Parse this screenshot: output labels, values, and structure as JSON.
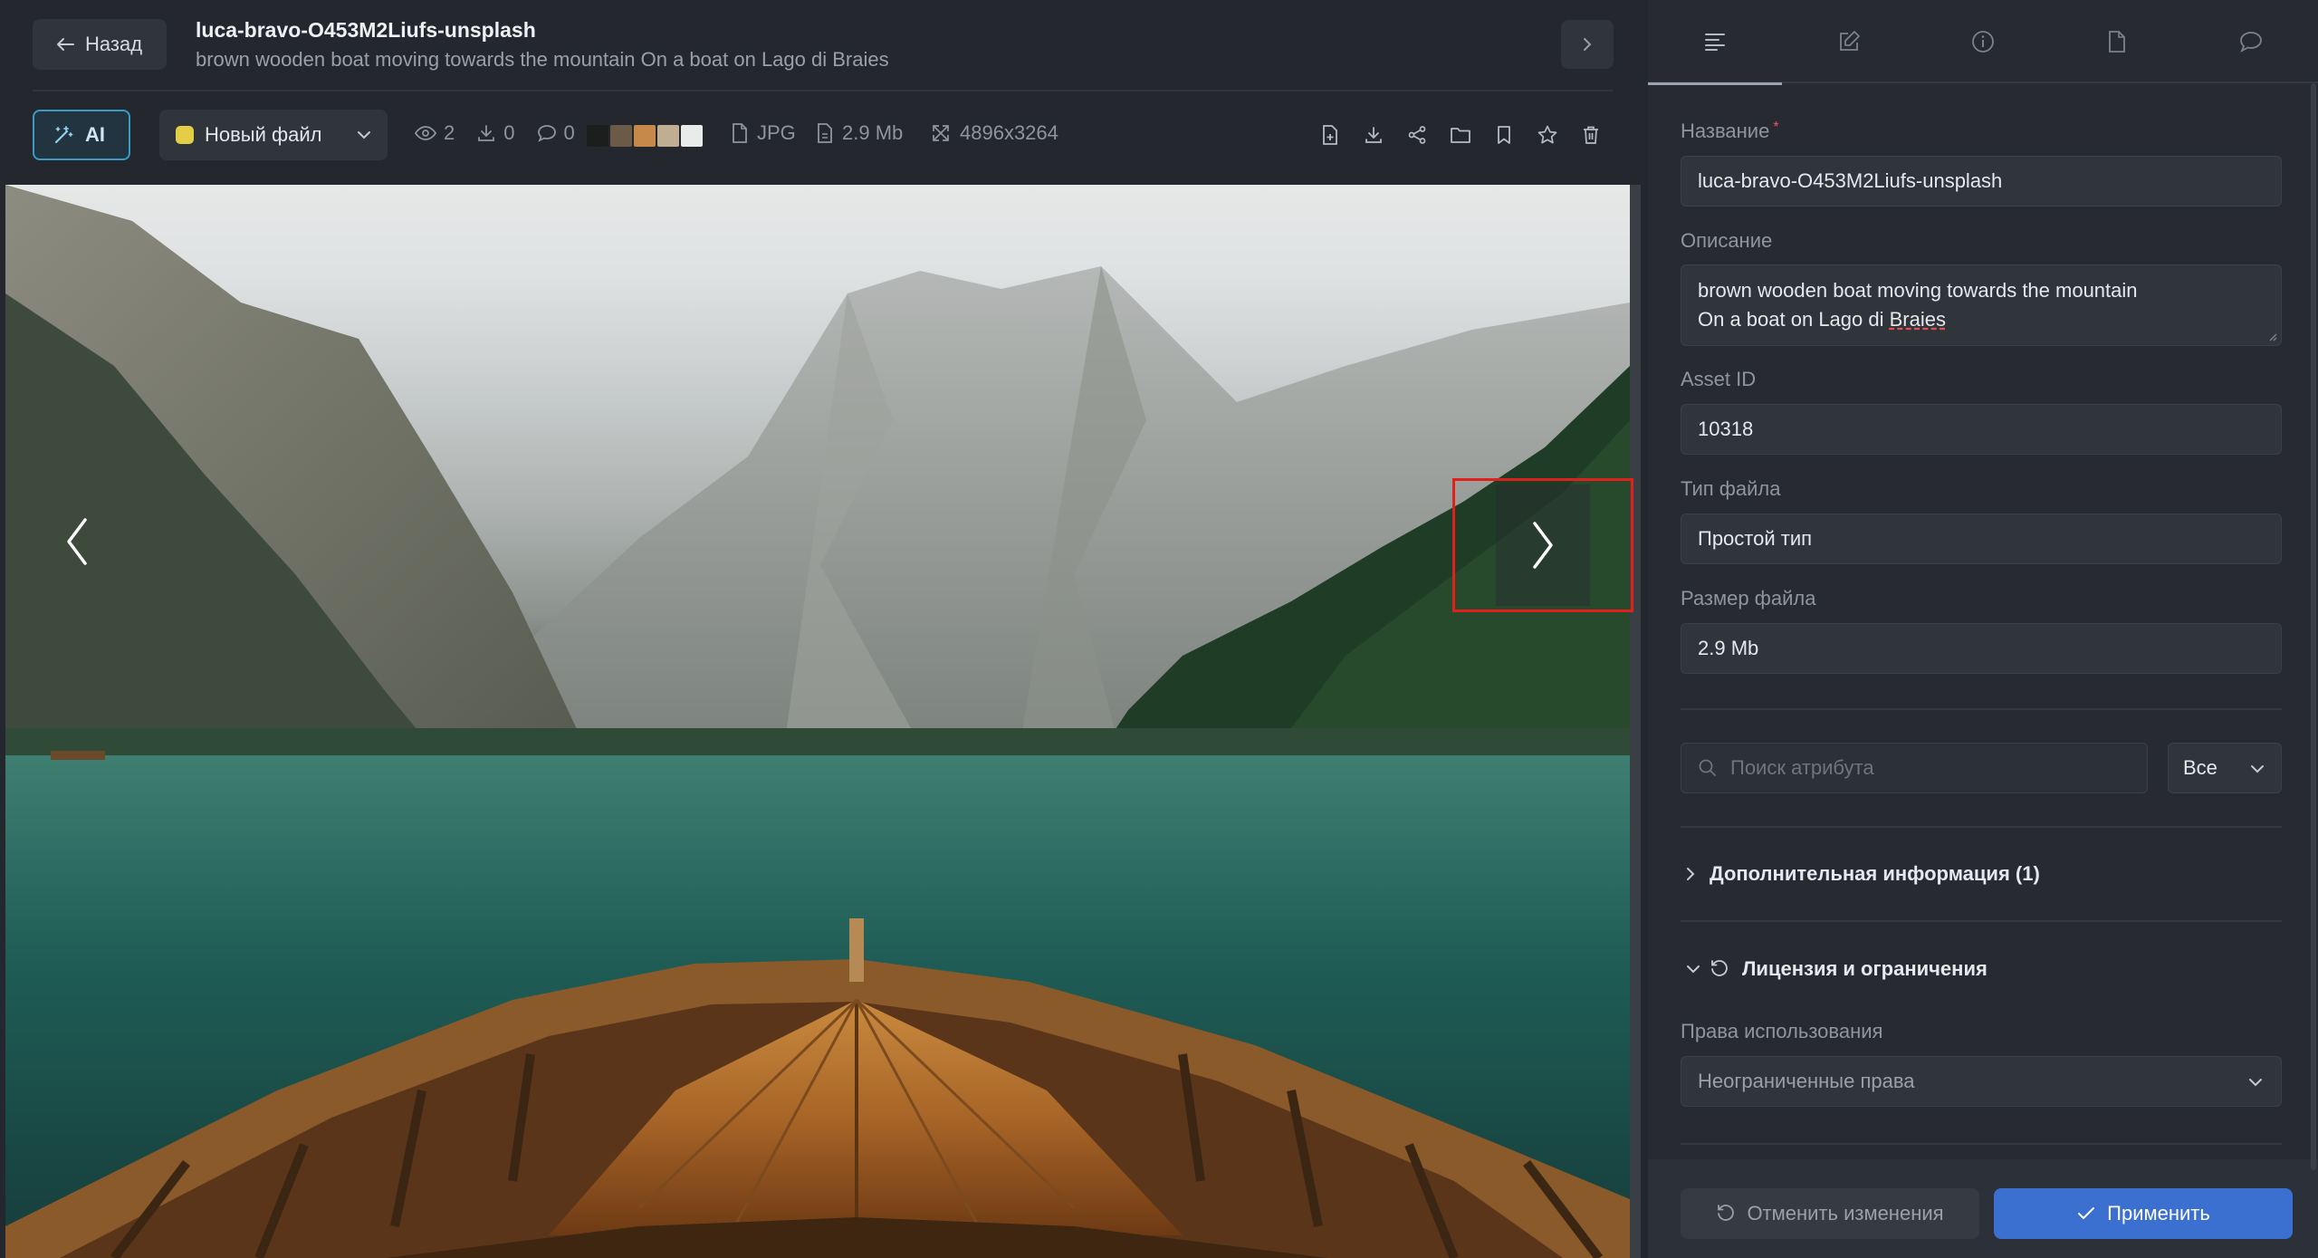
{
  "header": {
    "back_label": "Назад",
    "file_title": "luca-bravo-O453M2Liufs-unsplash",
    "file_subtitle": "brown wooden boat moving towards the mountain On a boat on Lago di Braies"
  },
  "toolbar": {
    "ai_label": "AI",
    "status_label": "Новый файл",
    "status_color": "#e4cd47",
    "views": "2",
    "downloads": "0",
    "comments": "0",
    "palette": [
      "#1c1e1d",
      "#6b5a45",
      "#c6894a",
      "#bfae92",
      "#e9ebea"
    ],
    "format": "JPG",
    "size": "2.9 Mb",
    "dimensions": "4896x3264",
    "actions": [
      "file-add-icon",
      "download-icon",
      "share-icon",
      "folder-icon",
      "bookmark-icon",
      "star-icon",
      "trash-icon"
    ]
  },
  "panel": {
    "tabs": [
      "list-icon",
      "edit-icon",
      "info-icon",
      "file-icon",
      "comment-icon"
    ],
    "name_label": "Название",
    "name_required": "*",
    "name_value": "luca-bravo-O453M2Liufs-unsplash",
    "description_label": "Описание",
    "description_line1": "brown wooden boat moving towards the mountain",
    "description_line2_prefix": "On a boat on Lago di ",
    "description_line2_word": "Braies",
    "asset_id_label": "Asset ID",
    "asset_id_value": "10318",
    "file_type_label": "Тип файла",
    "file_type_value": "Простой тип",
    "file_size_label": "Размер файла",
    "file_size_value": "2.9 Mb",
    "attr_search_placeholder": "Поиск атрибута",
    "attr_filter_value": "Все",
    "extra_info_label": "Дополнительная информация (1)",
    "license_label": "Лицензия и ограничения",
    "usage_rights_label": "Права использования",
    "usage_rights_value": "Неограниченные права",
    "cancel_label": "Отменить изменения",
    "apply_label": "Применить"
  },
  "colors": {
    "accent": "#3b6fd0",
    "ai_border": "#3a9bc4",
    "highlight": "#e0201b"
  }
}
